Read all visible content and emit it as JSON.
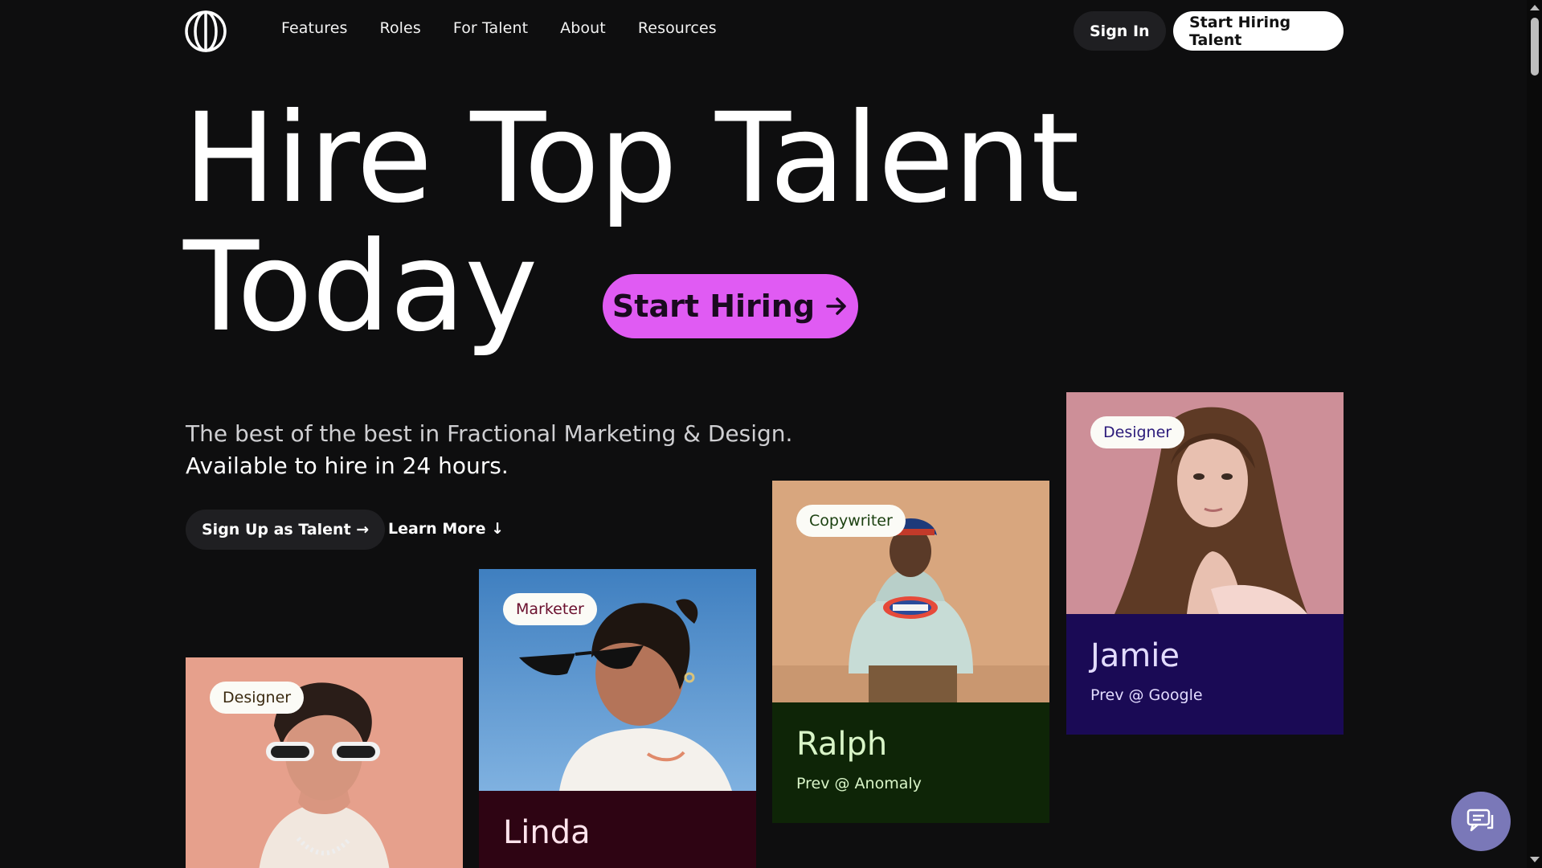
{
  "nav": {
    "links": [
      "Features",
      "Roles",
      "For Talent",
      "About",
      "Resources"
    ],
    "sign_in": "Sign In",
    "start_hiring_talent": "Start Hiring Talent"
  },
  "hero": {
    "line1": "Hire Top Talent",
    "line2": "Today",
    "cta": "Start Hiring",
    "subtitle_line1": "The best of the best in Fractional Marketing & Design.",
    "subtitle_line2": "Available to hire in 24 hours.",
    "signup_label": "Sign Up as Talent →",
    "learn_more_label": "Learn More ↓",
    "accent_color": "#e05bf3"
  },
  "cards": [
    {
      "tag": "Designer",
      "name": "",
      "prev": "",
      "tag_color": "#3a2a10"
    },
    {
      "tag": "Marketer",
      "name": "Linda",
      "prev": "",
      "tag_color": "#6a0f2d"
    },
    {
      "tag": "Copywriter",
      "name": "Ralph",
      "prev": "Prev @ Anomaly",
      "tag_color": "#1b4010"
    },
    {
      "tag": "Designer",
      "name": "Jamie",
      "prev": "Prev @ Google",
      "tag_color": "#2b1a7a"
    }
  ],
  "icons": {
    "logo": "globe-logo-icon",
    "chat": "chat-bubble-icon"
  }
}
